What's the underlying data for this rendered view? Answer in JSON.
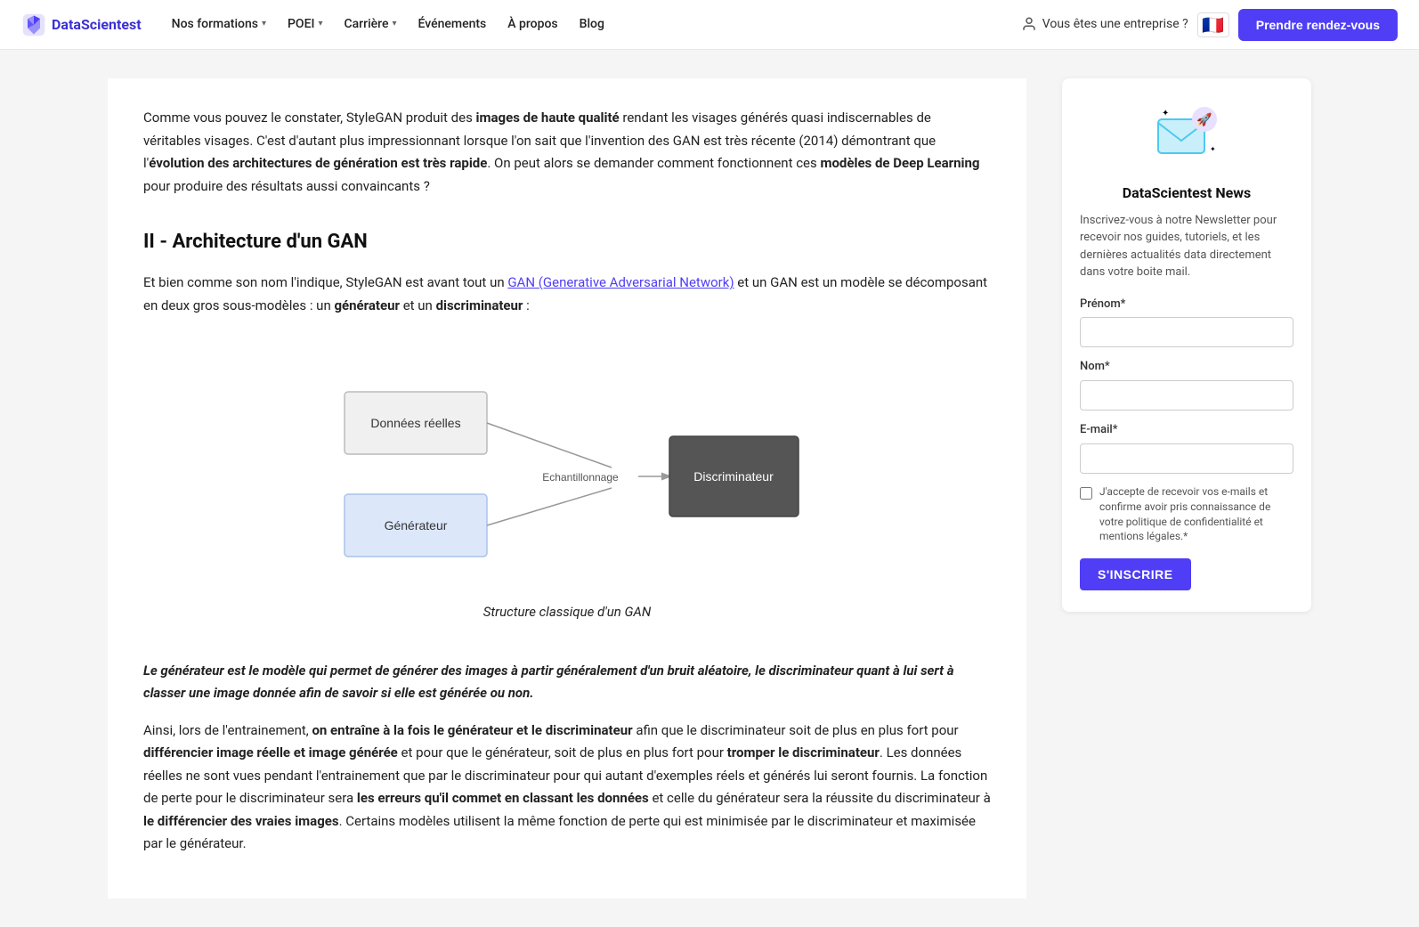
{
  "navbar": {
    "logo_text": "DataScientest",
    "nos_formations": "Nos formations",
    "poei": "POEI",
    "carriere": "Carrière",
    "evenements": "Événements",
    "a_propos": "À propos",
    "blog": "Blog",
    "enterprise_label": "Vous êtes une entreprise ?",
    "cta_label": "Prendre rendez-vous"
  },
  "article": {
    "intro_paragraph": "Comme vous pouvez le constater, StyleGAN produit des ",
    "intro_bold1": "images de haute qualité",
    "intro_rest": " rendant les visages générés quasi indiscernables de véritables visages. C'est d'autant plus impressionnant lorsque l'on sait que l'invention des GAN est très récente (2014) démontrant que l'",
    "intro_bold2": "évolution des architectures de génération est très rapide",
    "intro_end": ". On peut alors se demander comment fonctionnent ces ",
    "intro_bold3": "modèles de Deep Learning",
    "intro_final": " pour produire des résultats aussi convaincants ?",
    "section_title": "II - Architecture d'un GAN",
    "section_intro": "Et bien comme son nom l'indique, StyleGAN est avant tout un ",
    "gan_link": "GAN (Generative Adversarial Network)",
    "section_intro2": " et un GAN est un modèle se décomposant en deux gros sous-modèles : un ",
    "generateur_bold": "générateur",
    "section_intro3": " et un ",
    "discriminateur_bold": "discriminateur",
    "section_intro4": " :",
    "diagram_caption": "Structure classique d'un GAN",
    "diagram_nodes": {
      "donnees_reelles": "Données réelles",
      "generateur": "Générateur",
      "echantillonnage": "Echantillonnage",
      "discriminateur": "Discriminateur"
    },
    "blockquote": "Le générateur est le modèle qui permet de générer des images à partir généralement d'un bruit aléatoire, le discriminateur quant à lui sert à classer une image donnée afin de savoir si elle est générée ou non.",
    "body_paragraph1_start": "Ainsi, lors de l'entrainement, ",
    "body_bold1": "on entraîne à la fois le générateur et le discriminateur",
    "body_paragraph1_mid": " afin que le discriminateur soit de plus en plus fort pour ",
    "body_bold2": "différencier image réelle et image générée",
    "body_paragraph1_mid2": " et pour que le générateur, soit de plus en plus fort pour ",
    "body_bold3": "tromper le discriminateur",
    "body_paragraph1_end": ". Les données réelles ne sont vues pendant l'entrainement que par le discriminateur pour qui autant d'exemples réels et générés lui seront fournis. La fonction de perte pour le discriminateur sera ",
    "body_bold4": "les erreurs qu'il commet en classant les données",
    "body_paragraph1_end2": " et celle du générateur sera la réussite du discriminateur à ",
    "body_bold5": "le différencier des vraies images",
    "body_paragraph1_final": ". Certains modèles utilisent la même fonction de perte qui est minimisée par le discriminateur et maximisée par le générateur."
  },
  "newsletter": {
    "title": "DataScientest News",
    "description": "Inscrivez-vous à notre Newsletter pour recevoir nos guides, tutoriels, et les dernières actualités data directement dans votre boite mail.",
    "prenom_label": "Prénom*",
    "nom_label": "Nom*",
    "email_label": "E-mail*",
    "checkbox_text": "J'accepte de recevoir vos e-mails et confirme avoir pris connaissance de votre politique de confidentialité et mentions légales.*",
    "subscribe_btn": "S'INSCRIRE"
  }
}
